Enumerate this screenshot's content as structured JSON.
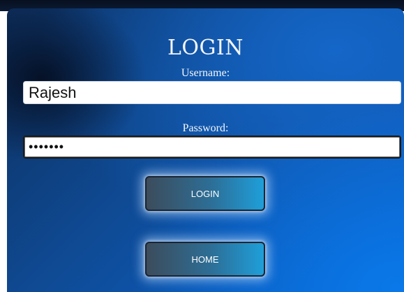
{
  "form": {
    "title": "LOGIN",
    "username_label": "Username:",
    "username_value": "Rajesh",
    "password_label": "Password:",
    "password_value": "•••••••",
    "login_button": "LOGIN",
    "home_button": "HOME"
  },
  "colors": {
    "panel_dark": "#0d2e5c",
    "panel_bright": "#0a64d4",
    "button_left": "#3c4c5c",
    "button_right": "#1e9fda"
  }
}
